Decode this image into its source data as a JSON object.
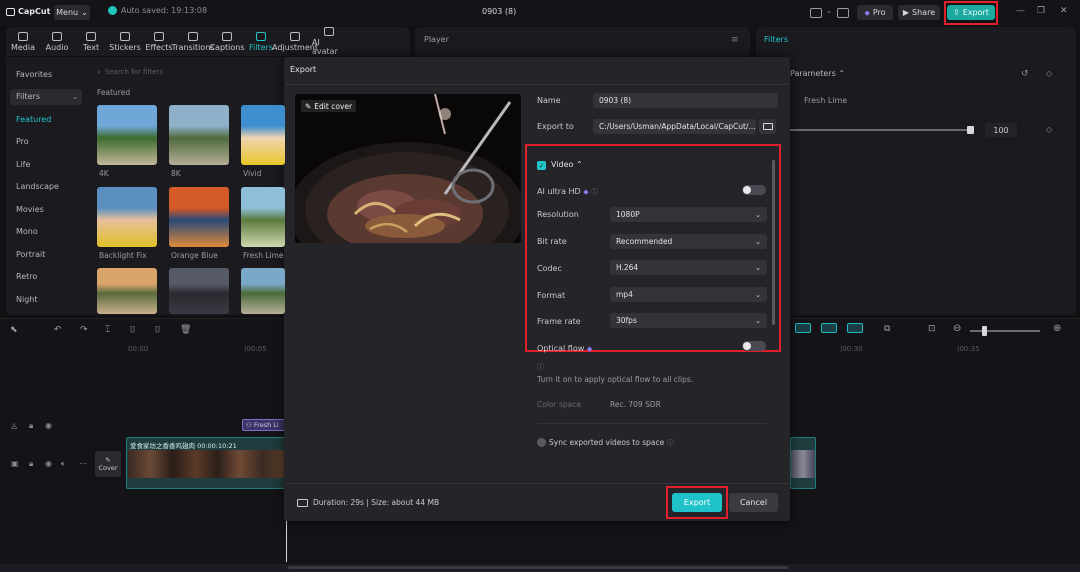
{
  "app": {
    "logo": "CapCut",
    "menu_label": "Menu",
    "autosave": "Auto saved: 19:13:08",
    "project_title": "0903 (8)",
    "pro_label": "Pro",
    "share_label": "Share",
    "export_label": "Export"
  },
  "toolbar": {
    "tools": [
      "Media",
      "Audio",
      "Text",
      "Stickers",
      "Effects",
      "Transitions",
      "Captions",
      "Filters",
      "Adjustment",
      "AI avatar"
    ],
    "active": "Filters"
  },
  "left_panel": {
    "sidebar": [
      "Favorites",
      "Filters",
      "Featured",
      "Pro",
      "Life",
      "Landscape",
      "Movies",
      "Mono",
      "Portrait",
      "Retro",
      "Night"
    ],
    "search_placeholder": "Search for filters",
    "featured_label": "Featured",
    "thumbs": [
      {
        "label": "4K",
        "colors": [
          "#6ea7d8",
          "#3d6b2e",
          "#c2b89a"
        ]
      },
      {
        "label": "8K",
        "colors": [
          "#8fb0c9",
          "#4f6b3c",
          "#b6ad97"
        ]
      },
      {
        "label": "Vivid",
        "colors": [
          "#3f8fd0",
          "#f0d4b0",
          "#e8c72a"
        ]
      },
      {
        "label": "Backlight Fix",
        "colors": [
          "#5a8fc0",
          "#e6c09a",
          "#e0c028"
        ]
      },
      {
        "label": "Orange Blue",
        "colors": [
          "#d45a28",
          "#2a4a78",
          "#e08a3a"
        ]
      },
      {
        "label": "Fresh Lime",
        "colors": [
          "#8fbfd8",
          "#5a7a3e",
          "#cfd8b0"
        ]
      },
      {
        "label": "",
        "colors": [
          "#d9a46a",
          "#5a6a3e",
          "#c8b08a"
        ]
      },
      {
        "label": "",
        "colors": [
          "#555a66",
          "#2a2a30",
          "#3a3a44"
        ]
      },
      {
        "label": "",
        "colors": [
          "#7aa8c8",
          "#4a6a38",
          "#b8b098"
        ]
      }
    ]
  },
  "player": {
    "title": "Player"
  },
  "right_panel": {
    "title": "Filters",
    "params_label": "Parameters",
    "filter_name": "Fresh Lime",
    "intensity_value": "100"
  },
  "timeline": {
    "ruler": [
      "00:00",
      "|00:05",
      "|00:30",
      "|00:35"
    ],
    "fx_clip_label": "Fresh Li",
    "clip_label": "爱食家坊之香香鸡翅肉  00:00:10:21",
    "cover_label": "Cover"
  },
  "dialog": {
    "title": "Export",
    "edit_cover": "Edit cover",
    "name_label": "Name",
    "name_value": "0903 (8)",
    "export_to_label": "Export to",
    "export_to_value": "C:/Users/Usman/AppData/Local/CapCut/...",
    "video_label": "Video",
    "ai_hd_label": "AI ultra HD",
    "resolution_label": "Resolution",
    "resolution_value": "1080P",
    "bitrate_label": "Bit rate",
    "bitrate_value": "Recommended",
    "codec_label": "Codec",
    "codec_value": "H.264",
    "format_label": "Format",
    "format_value": "mp4",
    "framerate_label": "Frame rate",
    "framerate_value": "30fps",
    "optical_flow_label": "Optical flow",
    "optical_flow_help": "Turn it on to apply optical flow to all clips.",
    "color_space_label": "Color space",
    "color_space_value": "Rec. 709 SDR",
    "sync_label": "Sync exported videos to space",
    "duration": "Duration: 29s | Size: about 44 MB",
    "export_button": "Export",
    "cancel_button": "Cancel"
  },
  "colors": {
    "accent": "#22c5c8",
    "highlight": "#e0202a",
    "dialog_bg": "#242429"
  }
}
